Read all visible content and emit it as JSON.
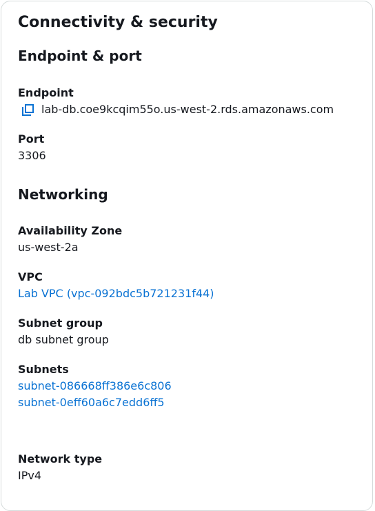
{
  "panel": {
    "title": "Connectivity & security"
  },
  "endpoint_port": {
    "heading": "Endpoint & port",
    "endpoint_label": "Endpoint",
    "endpoint_value": "lab-db.coe9kcqim55o.us-west-2.rds.amazonaws.com",
    "copy_icon": "copy-icon",
    "port_label": "Port",
    "port_value": "3306"
  },
  "networking": {
    "heading": "Networking",
    "az_label": "Availability Zone",
    "az_value": "us-west-2a",
    "vpc_label": "VPC",
    "vpc_value": "Lab VPC (vpc-092bdc5b721231f44)",
    "subnet_group_label": "Subnet group",
    "subnet_group_value": "db subnet group",
    "subnets_label": "Subnets",
    "subnets": [
      "subnet-086668ff386e6c806",
      "subnet-0eff60a6c7edd6ff5"
    ],
    "network_type_label": "Network type",
    "network_type_value": "IPv4"
  },
  "colors": {
    "link": "#0972d3",
    "text": "#16191f",
    "border": "#d5dbdb"
  }
}
